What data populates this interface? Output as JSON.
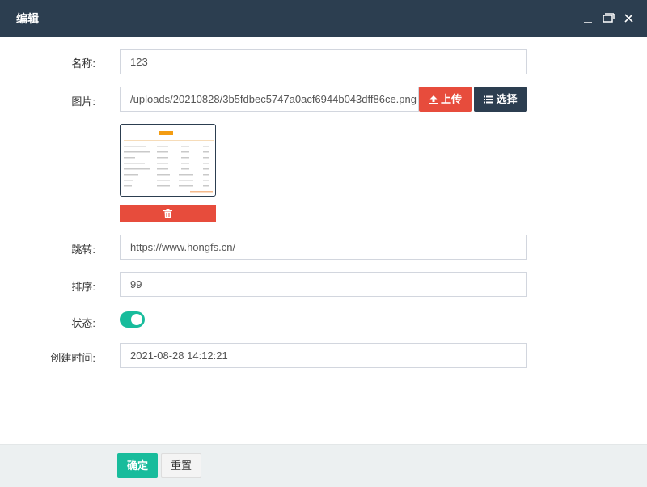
{
  "dialog": {
    "title": "编辑",
    "controls": {
      "minimize": "minimize-icon",
      "maximize": "maximize-icon",
      "close": "close-icon"
    }
  },
  "form": {
    "name": {
      "label": "名称:",
      "value": "123"
    },
    "image": {
      "label": "图片:",
      "value": "/uploads/20210828/3b5fdbec5747a0acf6944b043dff86ce.png",
      "upload_label": "上传",
      "choose_label": "选择",
      "upload_icon": "upload-icon",
      "choose_icon": "list-icon",
      "delete_icon": "trash-icon"
    },
    "link": {
      "label": "跳转:",
      "value": "https://www.hongfs.cn/"
    },
    "sort": {
      "label": "排序:",
      "value": "99"
    },
    "status": {
      "label": "状态:",
      "enabled": true
    },
    "created": {
      "label": "创建时间:",
      "value": "2021-08-28 14:12:21"
    }
  },
  "footer": {
    "ok_label": "确定",
    "reset_label": "重置"
  },
  "colors": {
    "header": "#2c3e50",
    "danger": "#e74c3c",
    "success": "#18bc9c",
    "footer_bg": "#ecf0f1"
  }
}
